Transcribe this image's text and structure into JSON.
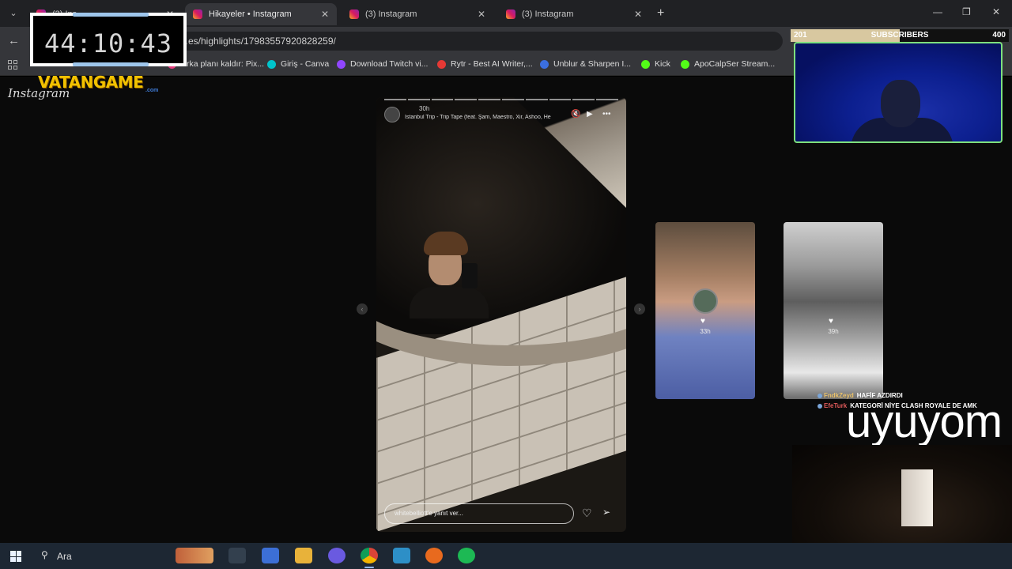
{
  "browser": {
    "tabs": [
      {
        "title": "(3) Ins"
      },
      {
        "title": "Hikayeler • Instagram"
      },
      {
        "title": "(3) Instagram"
      },
      {
        "title": "(3) Instagram"
      }
    ],
    "url": "…es/highlights/17983557920828259/",
    "bookmarks": [
      {
        "label": "Arka planı kaldır: Pix...",
        "color": "#e33b7c"
      },
      {
        "label": "Giriş - Canva",
        "color": "#00c4cc"
      },
      {
        "label": "Download Twitch vi...",
        "color": "#9146ff"
      },
      {
        "label": "Rytr - Best AI Writer,...",
        "color": "#e53935"
      },
      {
        "label": "Unblur & Sharpen I...",
        "color": "#3b6fe0"
      },
      {
        "label": "Kick",
        "color": "#53fc18"
      },
      {
        "label": "ApoCalpSer Stream...",
        "color": "#53fc18"
      }
    ]
  },
  "instagram": {
    "logo": "Instagram",
    "story": {
      "time": "30h",
      "music": "İstanbul Trip - Trip Tape (feat. Şam, Maestro, Xir, Ashoo, He",
      "reply_placeholder": "whitebelliott'e yanıt ver...",
      "mute_icon": "🔇",
      "play_icon": "▶",
      "more_icon": "•••"
    },
    "next_cards": [
      {
        "time": "33h"
      },
      {
        "time": "39h"
      }
    ]
  },
  "stream": {
    "timer": "44:10:43",
    "brand": "VATANGAME",
    "brand_sub": ".com",
    "subs_current": "201",
    "subs_label": "SUBSCRIBERS",
    "subs_goal": "400",
    "subs_progress": 0.5,
    "chat": [
      {
        "user": "FndkZeyd",
        "message": "HAFİF AZDIRDI"
      },
      {
        "user": "EfeTurk",
        "message": "KATEGORİ NİYE CLASH ROYALE DE AMK"
      }
    ],
    "overlay_text": "uyuyom"
  },
  "taskbar": {
    "search_placeholder": "Ara"
  },
  "colors": {
    "accent_green": "#7ee07e",
    "brand_yellow": "#f2c200"
  }
}
